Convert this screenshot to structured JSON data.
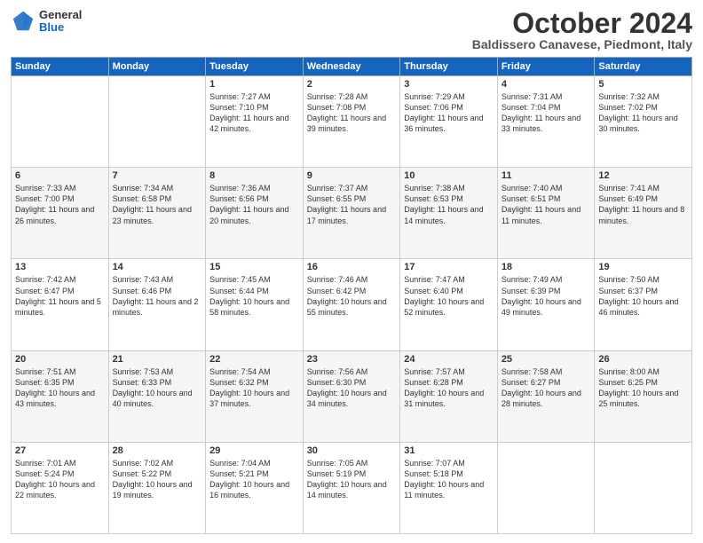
{
  "header": {
    "logo": {
      "general": "General",
      "blue": "Blue"
    },
    "title": "October 2024",
    "location": "Baldissero Canavese, Piedmont, Italy"
  },
  "days_of_week": [
    "Sunday",
    "Monday",
    "Tuesday",
    "Wednesday",
    "Thursday",
    "Friday",
    "Saturday"
  ],
  "weeks": [
    [
      {
        "day": null,
        "info": null
      },
      {
        "day": null,
        "info": null
      },
      {
        "day": "1",
        "info": "Sunrise: 7:27 AM\nSunset: 7:10 PM\nDaylight: 11 hours\nand 42 minutes."
      },
      {
        "day": "2",
        "info": "Sunrise: 7:28 AM\nSunset: 7:08 PM\nDaylight: 11 hours\nand 39 minutes."
      },
      {
        "day": "3",
        "info": "Sunrise: 7:29 AM\nSunset: 7:06 PM\nDaylight: 11 hours\nand 36 minutes."
      },
      {
        "day": "4",
        "info": "Sunrise: 7:31 AM\nSunset: 7:04 PM\nDaylight: 11 hours\nand 33 minutes."
      },
      {
        "day": "5",
        "info": "Sunrise: 7:32 AM\nSunset: 7:02 PM\nDaylight: 11 hours\nand 30 minutes."
      }
    ],
    [
      {
        "day": "6",
        "info": "Sunrise: 7:33 AM\nSunset: 7:00 PM\nDaylight: 11 hours\nand 26 minutes."
      },
      {
        "day": "7",
        "info": "Sunrise: 7:34 AM\nSunset: 6:58 PM\nDaylight: 11 hours\nand 23 minutes."
      },
      {
        "day": "8",
        "info": "Sunrise: 7:36 AM\nSunset: 6:56 PM\nDaylight: 11 hours\nand 20 minutes."
      },
      {
        "day": "9",
        "info": "Sunrise: 7:37 AM\nSunset: 6:55 PM\nDaylight: 11 hours\nand 17 minutes."
      },
      {
        "day": "10",
        "info": "Sunrise: 7:38 AM\nSunset: 6:53 PM\nDaylight: 11 hours\nand 14 minutes."
      },
      {
        "day": "11",
        "info": "Sunrise: 7:40 AM\nSunset: 6:51 PM\nDaylight: 11 hours\nand 11 minutes."
      },
      {
        "day": "12",
        "info": "Sunrise: 7:41 AM\nSunset: 6:49 PM\nDaylight: 11 hours\nand 8 minutes."
      }
    ],
    [
      {
        "day": "13",
        "info": "Sunrise: 7:42 AM\nSunset: 6:47 PM\nDaylight: 11 hours\nand 5 minutes."
      },
      {
        "day": "14",
        "info": "Sunrise: 7:43 AM\nSunset: 6:46 PM\nDaylight: 11 hours\nand 2 minutes."
      },
      {
        "day": "15",
        "info": "Sunrise: 7:45 AM\nSunset: 6:44 PM\nDaylight: 10 hours\nand 58 minutes."
      },
      {
        "day": "16",
        "info": "Sunrise: 7:46 AM\nSunset: 6:42 PM\nDaylight: 10 hours\nand 55 minutes."
      },
      {
        "day": "17",
        "info": "Sunrise: 7:47 AM\nSunset: 6:40 PM\nDaylight: 10 hours\nand 52 minutes."
      },
      {
        "day": "18",
        "info": "Sunrise: 7:49 AM\nSunset: 6:39 PM\nDaylight: 10 hours\nand 49 minutes."
      },
      {
        "day": "19",
        "info": "Sunrise: 7:50 AM\nSunset: 6:37 PM\nDaylight: 10 hours\nand 46 minutes."
      }
    ],
    [
      {
        "day": "20",
        "info": "Sunrise: 7:51 AM\nSunset: 6:35 PM\nDaylight: 10 hours\nand 43 minutes."
      },
      {
        "day": "21",
        "info": "Sunrise: 7:53 AM\nSunset: 6:33 PM\nDaylight: 10 hours\nand 40 minutes."
      },
      {
        "day": "22",
        "info": "Sunrise: 7:54 AM\nSunset: 6:32 PM\nDaylight: 10 hours\nand 37 minutes."
      },
      {
        "day": "23",
        "info": "Sunrise: 7:56 AM\nSunset: 6:30 PM\nDaylight: 10 hours\nand 34 minutes."
      },
      {
        "day": "24",
        "info": "Sunrise: 7:57 AM\nSunset: 6:28 PM\nDaylight: 10 hours\nand 31 minutes."
      },
      {
        "day": "25",
        "info": "Sunrise: 7:58 AM\nSunset: 6:27 PM\nDaylight: 10 hours\nand 28 minutes."
      },
      {
        "day": "26",
        "info": "Sunrise: 8:00 AM\nSunset: 6:25 PM\nDaylight: 10 hours\nand 25 minutes."
      }
    ],
    [
      {
        "day": "27",
        "info": "Sunrise: 7:01 AM\nSunset: 5:24 PM\nDaylight: 10 hours\nand 22 minutes."
      },
      {
        "day": "28",
        "info": "Sunrise: 7:02 AM\nSunset: 5:22 PM\nDaylight: 10 hours\nand 19 minutes."
      },
      {
        "day": "29",
        "info": "Sunrise: 7:04 AM\nSunset: 5:21 PM\nDaylight: 10 hours\nand 16 minutes."
      },
      {
        "day": "30",
        "info": "Sunrise: 7:05 AM\nSunset: 5:19 PM\nDaylight: 10 hours\nand 14 minutes."
      },
      {
        "day": "31",
        "info": "Sunrise: 7:07 AM\nSunset: 5:18 PM\nDaylight: 10 hours\nand 11 minutes."
      },
      {
        "day": null,
        "info": null
      },
      {
        "day": null,
        "info": null
      }
    ]
  ]
}
